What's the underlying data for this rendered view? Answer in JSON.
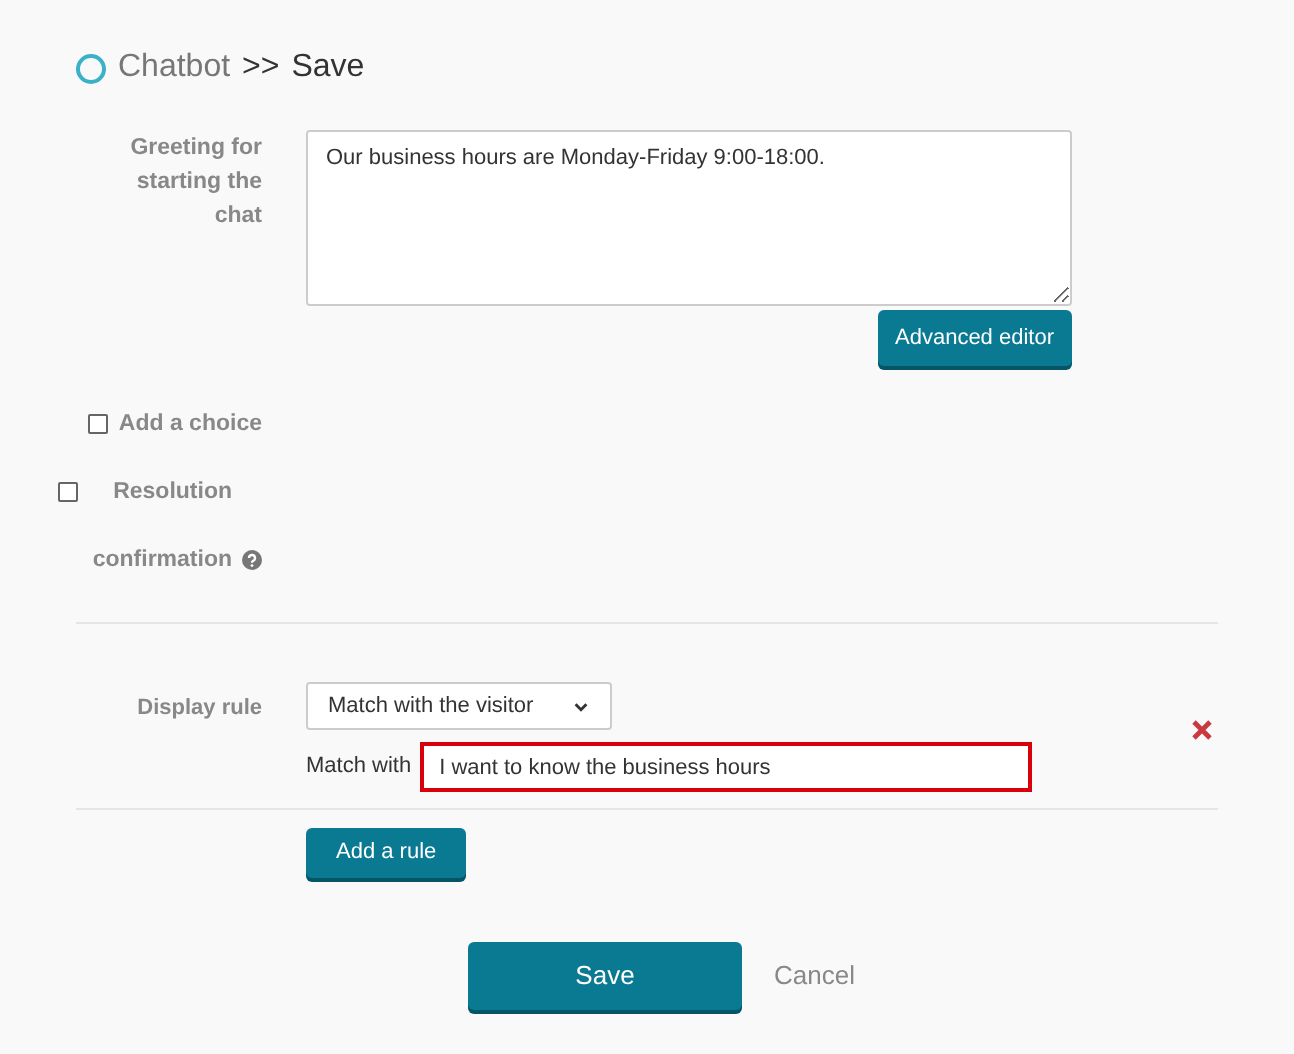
{
  "title": {
    "section": "Chatbot",
    "separator": ">>",
    "page": "Save"
  },
  "greeting": {
    "label": "Greeting for starting the chat",
    "value": "Our business hours are Monday-Friday 9:00-18:00.",
    "editor_button": "Advanced editor"
  },
  "options": [
    {
      "label": "Add a choice",
      "checked": false,
      "help": false
    },
    {
      "label": "Resolution confirmation",
      "checked": false,
      "help": true
    }
  ],
  "display_rule": {
    "label": "Display rule",
    "select": "Match with the visitor",
    "match_label": "Match with",
    "match_value": "I want to know the business hours",
    "highlighted": true,
    "add_button": "Add a rule"
  },
  "buttons": {
    "save": "Save",
    "cancel": "Cancel"
  }
}
